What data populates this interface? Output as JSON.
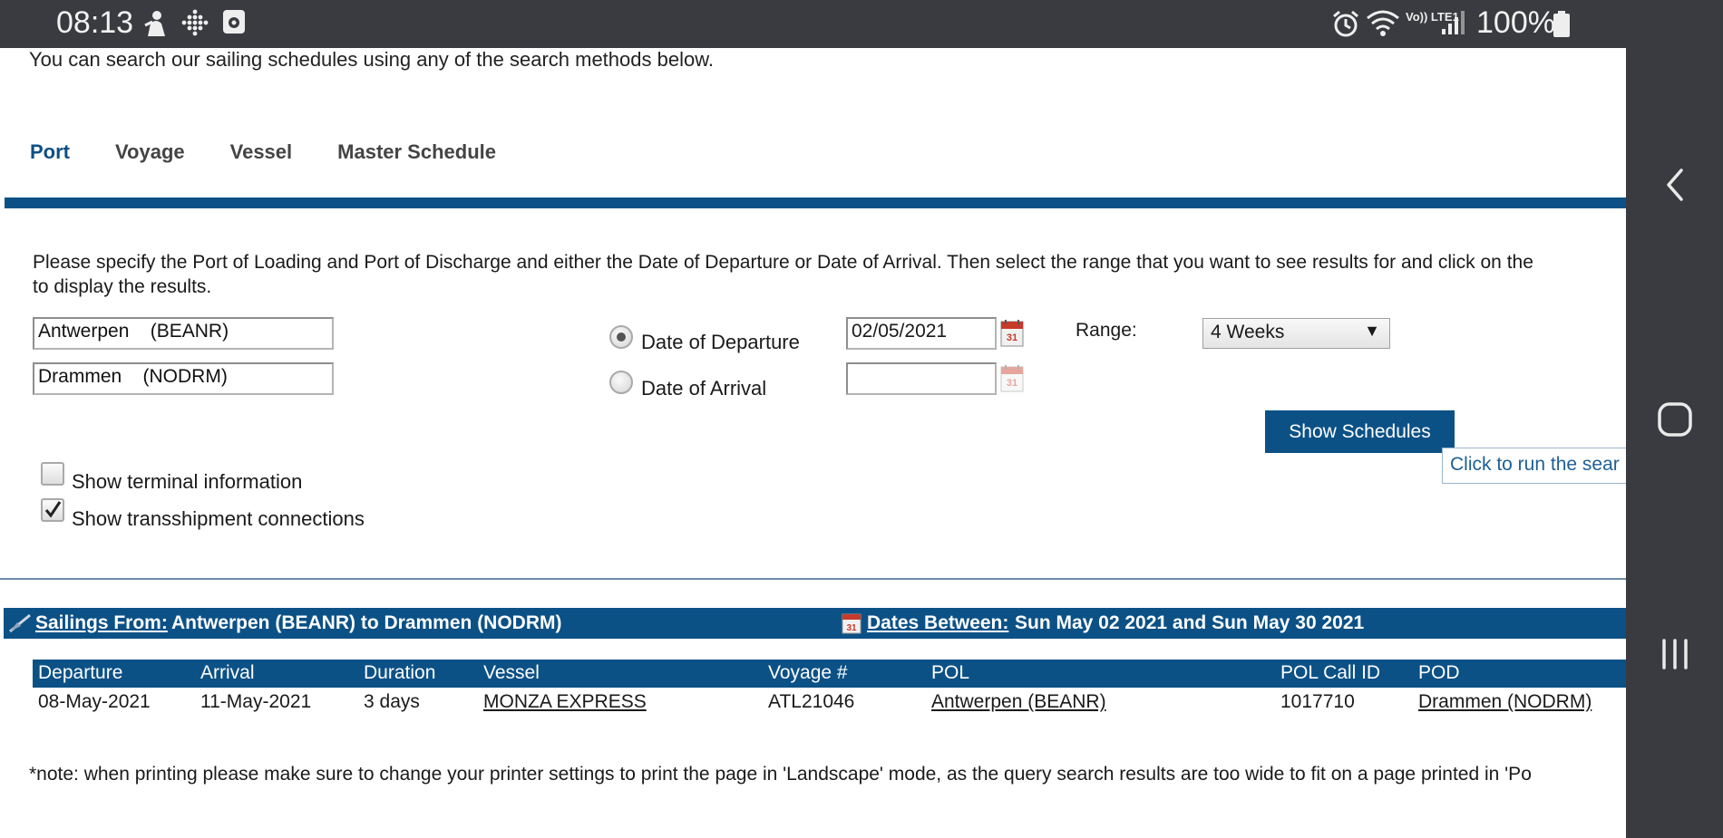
{
  "status_bar": {
    "time": "08:13",
    "battery": "100%",
    "icons": [
      "person-notification-icon",
      "dotted-grid-icon",
      "media-notification-icon",
      "alarm-icon",
      "wifi-icon",
      "volte-icon",
      "signal-icon",
      "battery-icon"
    ],
    "volte_label": "Vo)) LTE1"
  },
  "nav_bar": {
    "icons": [
      "back-icon",
      "home-icon",
      "recents-icon"
    ]
  },
  "page": {
    "intro": "You can search our sailing schedules using any of the search methods below.",
    "tabs": [
      {
        "label": "Port",
        "active": true
      },
      {
        "label": "Voyage",
        "active": false
      },
      {
        "label": "Vessel",
        "active": false
      },
      {
        "label": "Master Schedule",
        "active": false
      }
    ],
    "instructions_line1": "Please specify the Port of Loading and Port of Discharge and either the Date of Departure or Date of Arrival. Then select the range that you want to see results for and click on the",
    "instructions_line2": "to display the results.",
    "port_of_loading": "Antwerpen    (BEANR)",
    "port_of_discharge": "Drammen    (NODRM)",
    "date_of_departure_label": "Date of Departure",
    "date_of_arrival_label": "Date of Arrival",
    "departure_date": "02/05/2021",
    "arrival_date": "",
    "date_mode": "departure",
    "range_label": "Range:",
    "range_value": "4 Weeks",
    "show_button": "Show Schedules",
    "tooltip": "Click to run the sear",
    "show_terminal_label": "Show terminal information",
    "show_terminal_checked": false,
    "show_transshipment_label": "Show transshipment connections",
    "show_transshipment_checked": true,
    "accent_color": "#0c5186"
  },
  "results": {
    "sailings_from_label": "Sailings From:",
    "sailings_from_value": "Antwerpen (BEANR) to Drammen (NODRM)",
    "dates_between_label": "Dates Between:",
    "dates_between_value": "Sun May 02 2021 and Sun May 30 2021",
    "columns": [
      "Departure",
      "Arrival",
      "Duration",
      "Vessel",
      "Voyage #",
      "POL",
      "POL Call ID",
      "POD"
    ],
    "rows": [
      [
        "08-May-2021",
        "11-May-2021",
        "3 days",
        "MONZA EXPRESS",
        "ATL21046",
        "Antwerpen (BEANR)",
        "1017710",
        "Drammen (NODRM)"
      ]
    ],
    "note": "*note: when printing please make sure to change your printer settings to print the page in 'Landscape' mode, as the query search results are too wide to fit on a page printed in 'Po"
  }
}
